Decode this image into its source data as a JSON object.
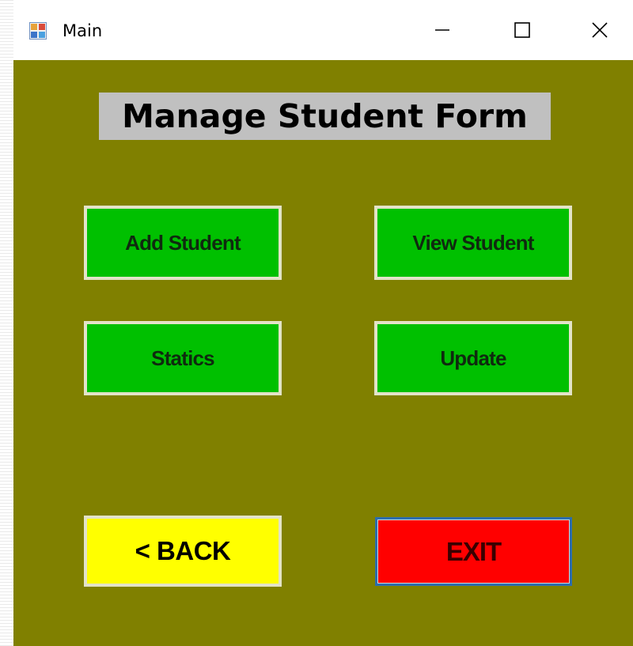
{
  "window": {
    "title": "Main",
    "icon": "windows-form-icon",
    "controls": {
      "minimize_icon": "minimize-icon",
      "maximize_icon": "maximize-icon",
      "close_icon": "close-icon"
    }
  },
  "form": {
    "heading": "Manage Student Form",
    "background_color": "#808000",
    "heading_background_color": "#c0c0c0"
  },
  "buttons": {
    "add_student": "Add Student",
    "view_student": "View Student",
    "statics": "Statics",
    "update": "Update",
    "back": "<  BACK",
    "exit": "EXIT"
  },
  "colors": {
    "action_button": "#00c000",
    "back_button": "#ffff00",
    "exit_button": "#ff0000"
  }
}
